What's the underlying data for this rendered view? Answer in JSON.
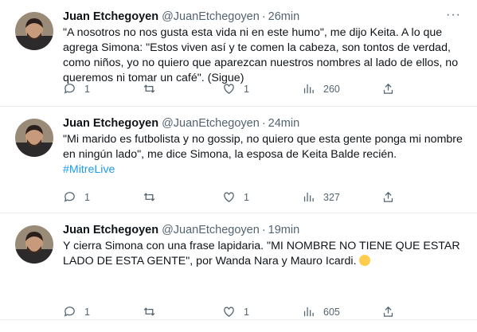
{
  "tweets": [
    {
      "name": "Juan Etchegoyen",
      "handle": "@JuanEtchegoyen",
      "separator": "·",
      "time": "26min",
      "more": "···",
      "text": "\"A nosotros no nos gusta esta vida ni en este humo\", me dijo Keita. A lo que agrega Simona: \"Estos viven así y te comen la cabeza, son tontos de verdad, como niños, yo no quiero que aparezcan nuestros nombres al lado de ellos, no queremos ni tomar un café\". (Sigue)",
      "hashtag": "",
      "replies": "1",
      "retweets": "",
      "likes": "1",
      "views": "260"
    },
    {
      "name": "Juan Etchegoyen",
      "handle": "@JuanEtchegoyen",
      "separator": "·",
      "time": "24min",
      "more": "",
      "text": "\"Mi marido es futbolista y no gossip, no quiero que esta gente ponga mi nombre en ningún lado\", me dice Simona, la esposa de Keita Balde recién.",
      "hashtag": "#MitreLive",
      "replies": "1",
      "retweets": "",
      "likes": "1",
      "views": "327"
    },
    {
      "name": "Juan Etchegoyen",
      "handle": "@JuanEtchegoyen",
      "separator": "·",
      "time": "19min",
      "more": "",
      "text": "Y cierra Simona con una frase lapidaria. \"MI NOMBRE NO TIENE QUE ESTAR LADO DE ESTA GENTE\", por Wanda Nara y Mauro Icardi.",
      "hashtag": "",
      "replies": "1",
      "retweets": "",
      "likes": "1",
      "views": "605"
    }
  ]
}
